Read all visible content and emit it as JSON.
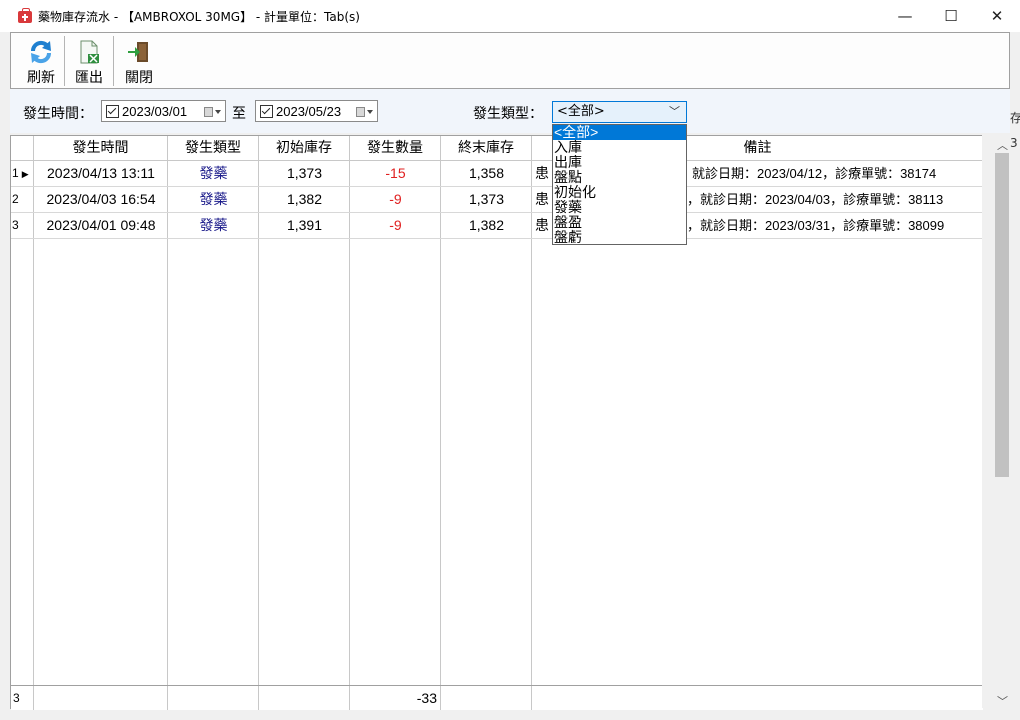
{
  "window": {
    "title": "藥物庫存流水 - 【AMBROXOL 30MG】 - 計量單位：Tab(s)",
    "minimize": "—",
    "maximize": "☐",
    "close": "✕"
  },
  "toolbar": {
    "refresh_label": "刷新",
    "export_label": "匯出",
    "close_label": "關閉"
  },
  "filter": {
    "time_label": "發生時間：",
    "date_from": "2023/03/01",
    "to_label": "至",
    "date_to": "2023/05/23",
    "type_label": "發生類型：",
    "type_selected": "<全部>",
    "type_options": [
      "<全部>",
      "入庫",
      "出庫",
      "盤點",
      "初始化",
      "發藥",
      "盤盈",
      "盤虧"
    ]
  },
  "table": {
    "columns": [
      "發生時間",
      "發生類型",
      "初始庫存",
      "發生數量",
      "終末庫存",
      "備註"
    ],
    "rows": [
      {
        "num": "1",
        "time": "2023/04/13 13:11",
        "type": "發藥",
        "start": "1,373",
        "qty": "-15",
        "end": "1,358",
        "note_prefix": "患",
        "note": "就診日期：2023/04/12，診療單號：38174"
      },
      {
        "num": "2",
        "time": "2023/04/03 16:54",
        "type": "發藥",
        "start": "1,382",
        "qty": "-9",
        "end": "1,373",
        "note_prefix": "患",
        "note": "，就診日期：2023/04/03，診療單號：38113"
      },
      {
        "num": "3",
        "time": "2023/04/01 09:48",
        "type": "發藥",
        "start": "1,391",
        "qty": "-9",
        "end": "1,382",
        "note_prefix": "患",
        "note": "，就診日期：2023/03/31，診療單號：38099"
      }
    ],
    "footer": {
      "count": "3",
      "qty_total": "-33"
    }
  },
  "right_strip": {
    "a": "存",
    "b": "3"
  },
  "colors": {
    "negative": "#e02020",
    "type_text": "#1a1a8a",
    "accent": "#0078d7"
  }
}
